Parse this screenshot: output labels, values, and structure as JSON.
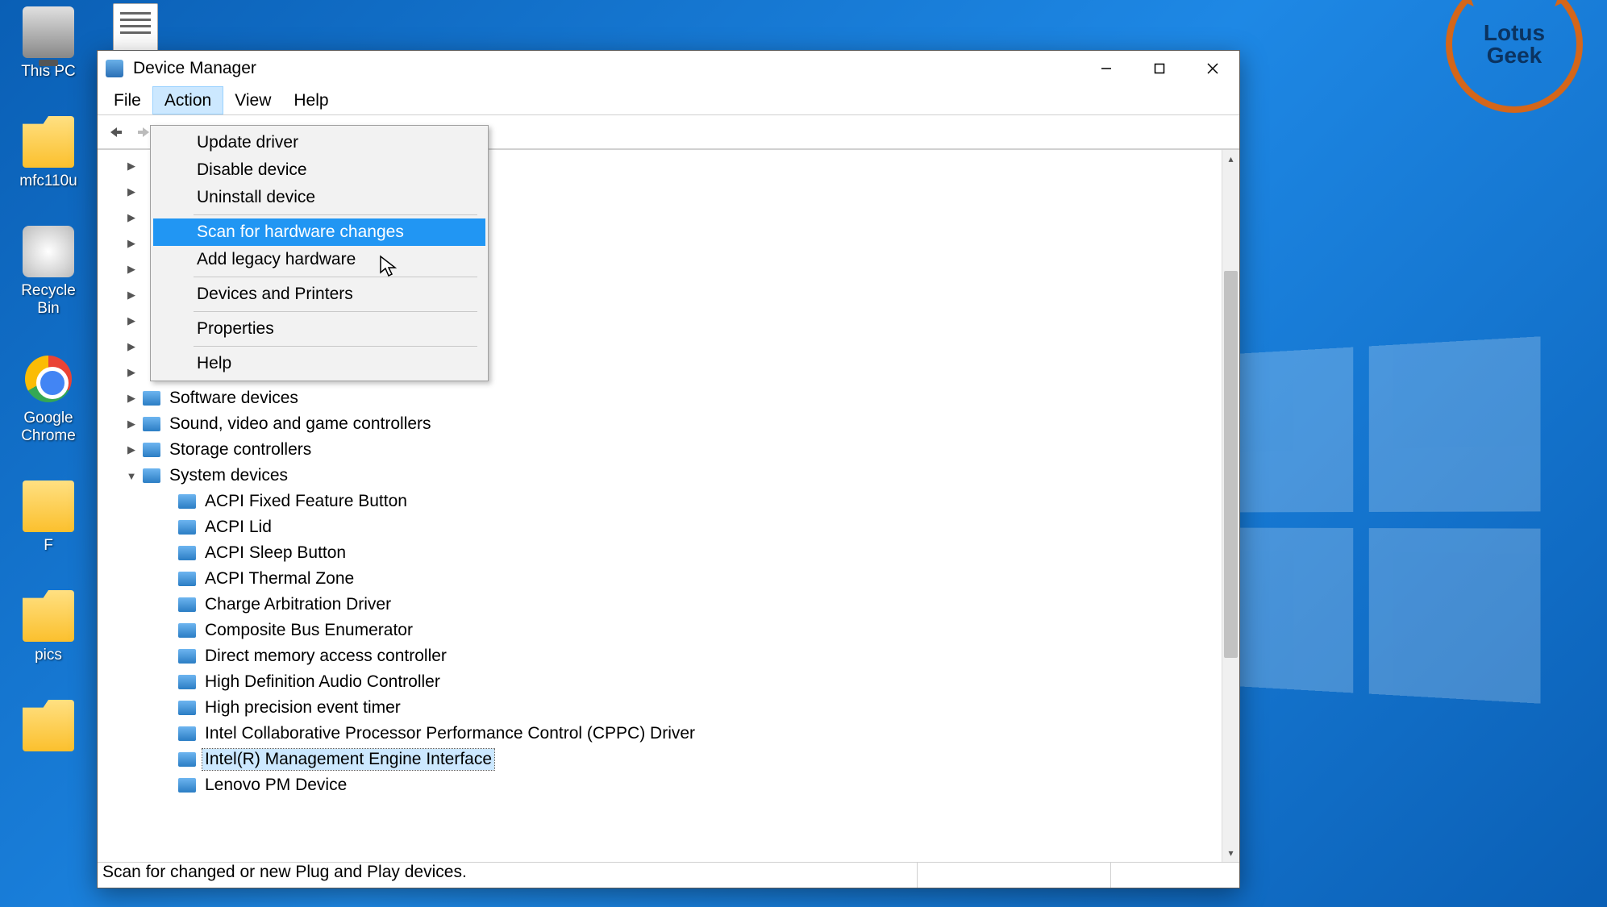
{
  "desktop": {
    "icons": [
      {
        "label": "This PC"
      },
      {
        "label": "mfc110u"
      },
      {
        "label": "Recycle Bin"
      },
      {
        "label": "Google Chrome"
      },
      {
        "label": "F"
      },
      {
        "label": "pics"
      }
    ],
    "text_file": ""
  },
  "brand": {
    "line1": "Lotus",
    "line2": "Geek"
  },
  "window": {
    "title": "Device Manager",
    "menus": [
      "File",
      "Action",
      "View",
      "Help"
    ],
    "active_menu_index": 1,
    "dropdown": {
      "groups": [
        [
          "Update driver",
          "Disable device",
          "Uninstall device"
        ],
        [
          "Scan for hardware changes",
          "Add legacy hardware"
        ],
        [
          "Devices and Printers"
        ],
        [
          "Properties"
        ],
        [
          "Help"
        ]
      ],
      "highlighted": "Scan for hardware changes"
    },
    "tree": {
      "collapsed_placeholder_count": 9,
      "partially_visible": [
        {
          "label": "Software devices",
          "expanded": false
        },
        {
          "label": "Sound, video and game controllers",
          "expanded": false
        },
        {
          "label": "Storage controllers",
          "expanded": false
        }
      ],
      "expanded_node": {
        "label": "System devices",
        "children": [
          "ACPI Fixed Feature Button",
          "ACPI Lid",
          "ACPI Sleep Button",
          "ACPI Thermal Zone",
          "Charge Arbitration Driver",
          "Composite Bus Enumerator",
          "Direct memory access controller",
          "High Definition Audio Controller",
          "High precision event timer",
          "Intel Collaborative Processor Performance Control (CPPC) Driver",
          "Intel(R) Management Engine Interface",
          "Lenovo PM Device"
        ],
        "selected_child": "Intel(R) Management Engine Interface"
      }
    },
    "statusbar": "Scan for changed or new Plug and Play devices."
  }
}
